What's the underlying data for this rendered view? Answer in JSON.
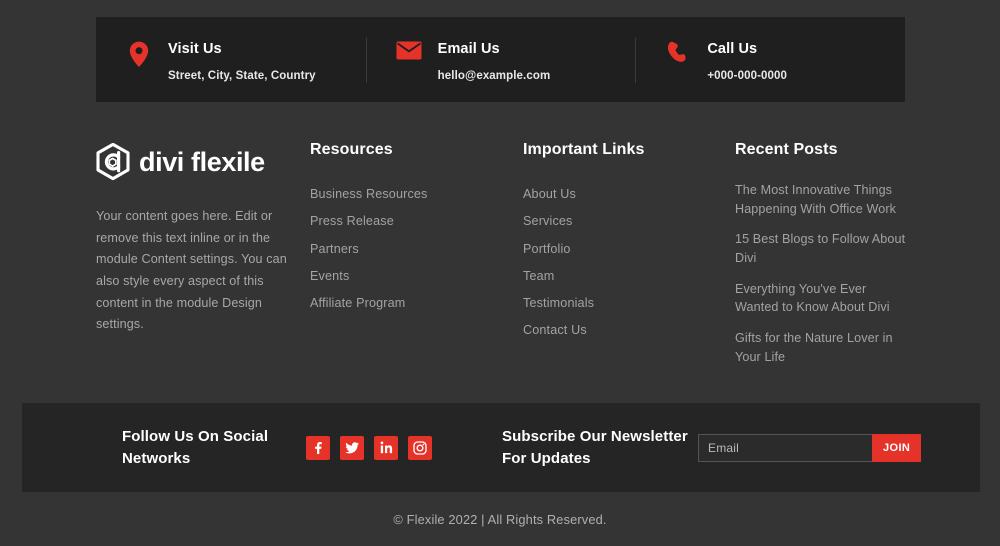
{
  "theme": {
    "page_bg": "#343434",
    "contact_bar_bg": "#1f1f1f",
    "bottom_bar_bg": "#252525",
    "accent": "#e63329",
    "heading_color": "#ffffff",
    "muted_text": "#a3a3a3"
  },
  "contact_bar": {
    "items": [
      {
        "icon": "map-pin-icon",
        "title": "Visit Us",
        "detail": "Street, City, State, Country"
      },
      {
        "icon": "envelope-icon",
        "title": "Email Us",
        "detail": "hello@example.com"
      },
      {
        "icon": "phone-icon",
        "title": "Call Us",
        "detail": "+000-000-0000"
      }
    ]
  },
  "brand": {
    "logo_icon": "divi-flexile-hexagon-logo-icon",
    "name": "divi flexile",
    "description": "Your content goes here. Edit or remove this text inline or in the module Content settings. You can also style every aspect of this content in the module Design settings."
  },
  "columns": [
    {
      "title": "Resources",
      "links": [
        "Business Resources",
        "Press Release",
        "Partners",
        "Events",
        "Affiliate Program"
      ]
    },
    {
      "title": "Important Links",
      "links": [
        "About Us",
        "Services",
        "Portfolio",
        "Team",
        "Testimonials",
        "Contact Us"
      ]
    },
    {
      "title": "Recent Posts",
      "links": [
        "The Most Innovative Things Happening With Office Work",
        "15 Best Blogs to Follow About Divi",
        "Everything You've Ever Wanted to Know About Divi",
        "Gifts for the Nature Lover in Your Life"
      ]
    }
  ],
  "social": {
    "heading": "Follow Us On Social Networks",
    "networks": [
      {
        "name": "facebook",
        "icon": "facebook-icon"
      },
      {
        "name": "twitter",
        "icon": "twitter-icon"
      },
      {
        "name": "linkedin",
        "icon": "linkedin-icon"
      },
      {
        "name": "instagram",
        "icon": "instagram-icon"
      }
    ]
  },
  "newsletter": {
    "heading": "Subscribe Our Newsletter For Updates",
    "email_value": "",
    "email_placeholder": "Email",
    "submit_label": "JOIN"
  },
  "footer": {
    "copyright": "© Flexile 2022 | All Rights Reserved."
  }
}
